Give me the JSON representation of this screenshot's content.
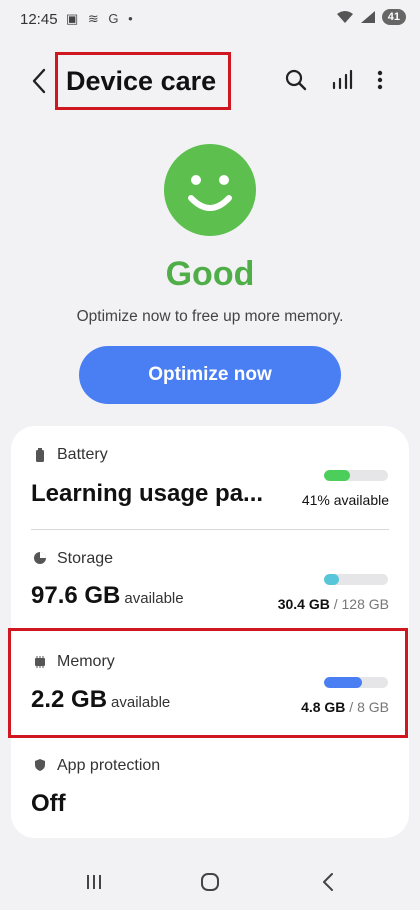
{
  "status_bar": {
    "time": "12:45",
    "left_icons": "▣ ≋ G •",
    "battery": "41"
  },
  "header": {
    "title": "Device care",
    "icons": [
      "back-arrow-icon",
      "search-icon",
      "chart-icon",
      "more-vert-icon"
    ]
  },
  "hero": {
    "status": "Good",
    "status_color": "#4fae48",
    "message": "Optimize now to free up more memory.",
    "button_label": "Optimize now"
  },
  "sections": {
    "battery": {
      "label": "Battery",
      "main": "Learning usage pa...",
      "right": "41% available",
      "level": 0.41,
      "color": "#4ccf5a"
    },
    "storage": {
      "label": "Storage",
      "main": "97.6 GB",
      "unit": "available",
      "used": "30.4 GB",
      "sep": " / ",
      "total": "128 GB",
      "level": 0.24,
      "color": "#56c6d8"
    },
    "memory": {
      "label": "Memory",
      "main": "2.2 GB",
      "unit": "available",
      "used": "4.8 GB",
      "sep": " / ",
      "total": "8 GB",
      "level": 0.6,
      "color": "#4a7ff4"
    },
    "app_protection": {
      "label": "App protection",
      "main": "Off"
    }
  },
  "nav_bar": [
    "recents-icon",
    "home-icon",
    "back-icon"
  ]
}
